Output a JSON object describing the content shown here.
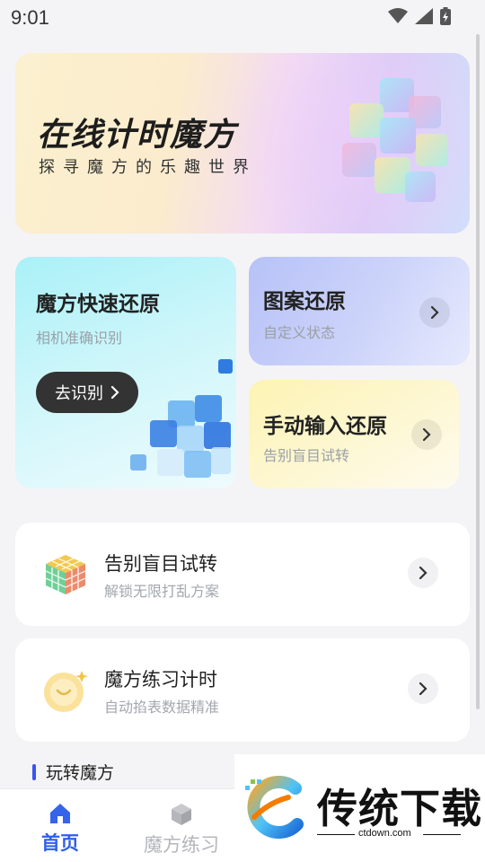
{
  "status_bar": {
    "time": "9:01"
  },
  "hero": {
    "title": "在线计时魔方",
    "subtitle": "探寻魔方的乐趣世界"
  },
  "scan_card": {
    "title": "魔方快速还原",
    "subtitle": "相机准确识别",
    "button_label": "去识别"
  },
  "pattern_card": {
    "title": "图案还原",
    "subtitle": "自定义状态"
  },
  "manual_card": {
    "title": "手动输入还原",
    "subtitle": "告别盲目试转"
  },
  "list": [
    {
      "title": "告别盲目试转",
      "subtitle": "解锁无限打乱方案",
      "icon": "rubiks-cube-icon"
    },
    {
      "title": "魔方练习计时",
      "subtitle": "自动掐表数据精准",
      "icon": "clock-icon"
    }
  ],
  "section": {
    "title": "玩转魔方"
  },
  "bottom_nav": [
    {
      "label": "首页",
      "icon": "home-icon",
      "active": true
    },
    {
      "label": "魔方练习",
      "icon": "cube-icon",
      "active": false
    }
  ],
  "watermark": {
    "brand": "传统下载",
    "domain": "ctdown.com"
  },
  "colors": {
    "accent": "#2f5ee8",
    "section_bar": "#3b53f0",
    "dark_button": "#333333"
  }
}
